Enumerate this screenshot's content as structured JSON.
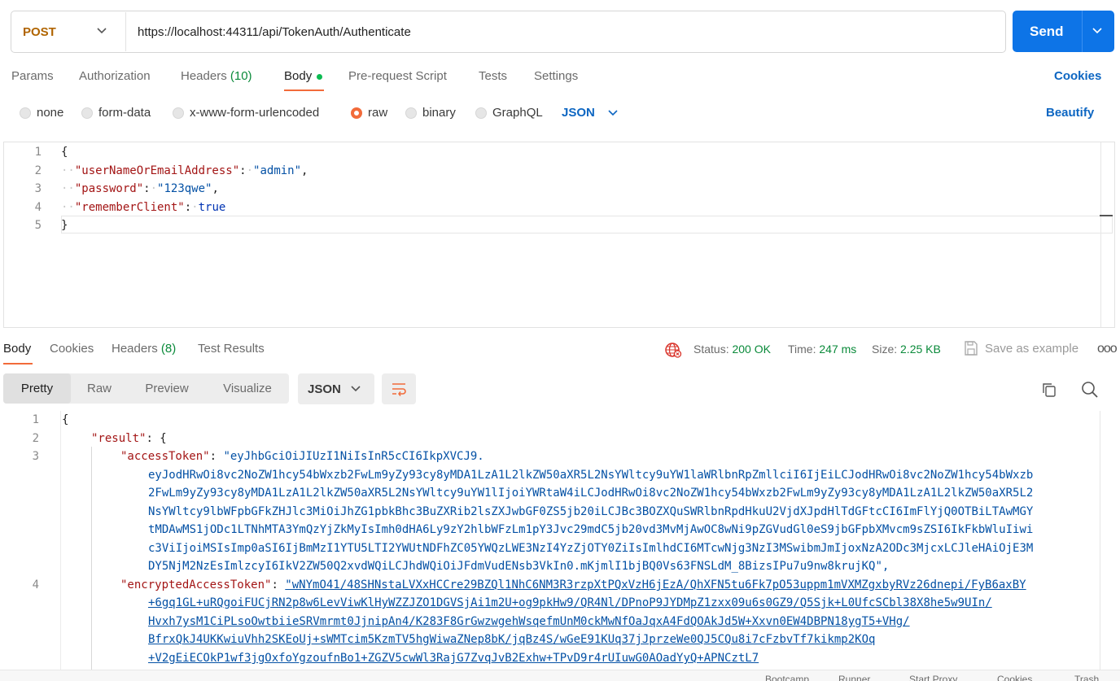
{
  "request": {
    "method": "POST",
    "url": "https://localhost:44311/api/TokenAuth/Authenticate",
    "send_label": "Send"
  },
  "request_tabs": {
    "params": "Params",
    "authorization": "Authorization",
    "headers": "Headers",
    "headers_count": "(10)",
    "body": "Body",
    "prerequest": "Pre-request Script",
    "tests": "Tests",
    "settings": "Settings",
    "cookies": "Cookies"
  },
  "body_types": {
    "none": "none",
    "form_data": "form-data",
    "urlencoded": "x-www-form-urlencoded",
    "raw": "raw",
    "binary": "binary",
    "graphql": "GraphQL",
    "selected": "raw",
    "format": "JSON",
    "beautify": "Beautify"
  },
  "request_body": {
    "line_numbers": [
      "1",
      "2",
      "3",
      "4",
      "5"
    ],
    "open_brace": "{",
    "close_brace": "}",
    "fields": [
      {
        "key": "\"userNameOrEmailAddress\"",
        "value": "\"admin\"",
        "trail": ","
      },
      {
        "key": "\"password\"",
        "value": "\"123qwe\"",
        "trail": ","
      },
      {
        "key": "\"rememberClient\"",
        "value": "true",
        "trail": ""
      }
    ]
  },
  "response_tabs": {
    "body": "Body",
    "cookies": "Cookies",
    "headers": "Headers",
    "headers_count": "(8)",
    "test_results": "Test Results"
  },
  "response_meta": {
    "status_label": "Status:",
    "status_value": "200 OK",
    "time_label": "Time:",
    "time_value": "247 ms",
    "size_label": "Size:",
    "size_value": "2.25 KB",
    "save_example": "Save as example",
    "more": "ooo"
  },
  "response_view": {
    "pretty": "Pretty",
    "raw": "Raw",
    "preview": "Preview",
    "visualize": "Visualize",
    "format": "JSON"
  },
  "response_body": {
    "line_numbers": [
      "1",
      "2",
      "3",
      "4"
    ],
    "l1": "{",
    "result_key": "\"result\"",
    "result_open": ": {",
    "access_token_key": "\"accessToken\"",
    "access_token_lines": [
      "\"eyJhbGciOiJIUzI1NiIsInR5cCI6IkpXVCJ9.",
      "eyJodHRwOi8vc2NoZW1hcy54bWxzb2FwLm9yZy93cy8yMDA1LzA1L2lkZW50aXR5L2NsYWltcy9uYW1laWRlbnRpZmllciI6IjEiLCJodHRwOi8vc2NoZW1hcy54bWxzb",
      "2FwLm9yZy93cy8yMDA1LzA1L2lkZW50aXR5L2NsYWltcy9uYW1lIjoiYWRtaW4iLCJodHRwOi8vc2NoZW1hcy54bWxzb2FwLm9yZy93cy8yMDA1LzA1L2lkZW50aXR5L2",
      "NsYWltcy9lbWFpbGFkZHJlc3MiOiJhZG1pbkBhc3BuZXRib2lsZXJwbGF0ZS5jb20iLCJBc3BOZXQuSWRlbnRpdHkuU2VjdXJpdHlTdGFtcCI6ImFlYjQ0OTBiLTAwMGY",
      "tMDAwMS1jODc1LTNhMTA3YmQzYjZkMyIsImh0dHA6Ly9zY2hlbWFzLm1pY3Jvc29mdC5jb20vd3MvMjAwOC8wNi9pZGVudGl0eS9jbGFpbXMvcm9sZSI6IkFkbWluIiwi",
      "c3ViIjoiMSIsImp0aSI6IjBmMzI1YTU5LTI2YWUtNDFhZC05YWQzLWE3NzI4YzZjOTY0ZiIsImlhdCI6MTcwNjg3NzI3MSwibmJmIjoxNzA2ODc3MjcxLCJleHAiOjE3M",
      "DY5NjM2NzEsImlzcyI6IkV2ZW50Q2xvdWQiLCJhdWQiOiJFdmVudENsb3VkIn0.mKjmlI1bjBQ0Vs63FNSLdM_8BizsIPu7u9nw8krujKQ\","
    ],
    "encrypted_key": "\"encryptedAccessToken\"",
    "encrypted_lines": [
      "\"wNYmO41/48SHNstaLVXxHCCre29BZQl1NhC6NM3R3rzpXtPQxVzH6jEzA/QhXFN5tu6Fk7pO53uppm1mVXMZgxbyRVz26dnepi/FyB6axBY",
      "+6gq1GL+uRQgoiFUCjRN2p8w6LevViwKlHyWZZJZO1DGVSjAi1m2U+og9pkHw9/QR4Nl/DPnoP9JYDMpZ1zxx09u6s0GZ9/Q5Sjk+L0UfcSCbl38X8he5w9UIn/",
      "Hvxh7ysM1CiPLsoOwtbiieSRVmrmt0JjnipAn4/K283F8GrGwzwgehWsqefmUnM0ckMwNfOaJqxA4FdQOAkJd5W+Xxvn0EW4DBPN18ygT5+VHg/",
      "BfrxQkJ4UKKwiuVhh2SKEoUj+sWMTcim5KzmTV5hgWiwaZNep8bK/jqBz4S/wGeE91KUq37jJprzeWe0QJ5CQu8i7cFzbvTf7kikmp2KOq",
      "+V2gEiECOkP1wf3jgOxfoYgzoufnBo1+ZGZV5cwWl3RajG7ZvqJvB2Exhw+TPvD9r4rUIuwG0AOadYyQ+APNCztL7"
    ]
  },
  "status_bar": {
    "items": [
      "Bootcamp",
      "Runner",
      "Start Proxy",
      "Cookies",
      "Trash"
    ]
  }
}
